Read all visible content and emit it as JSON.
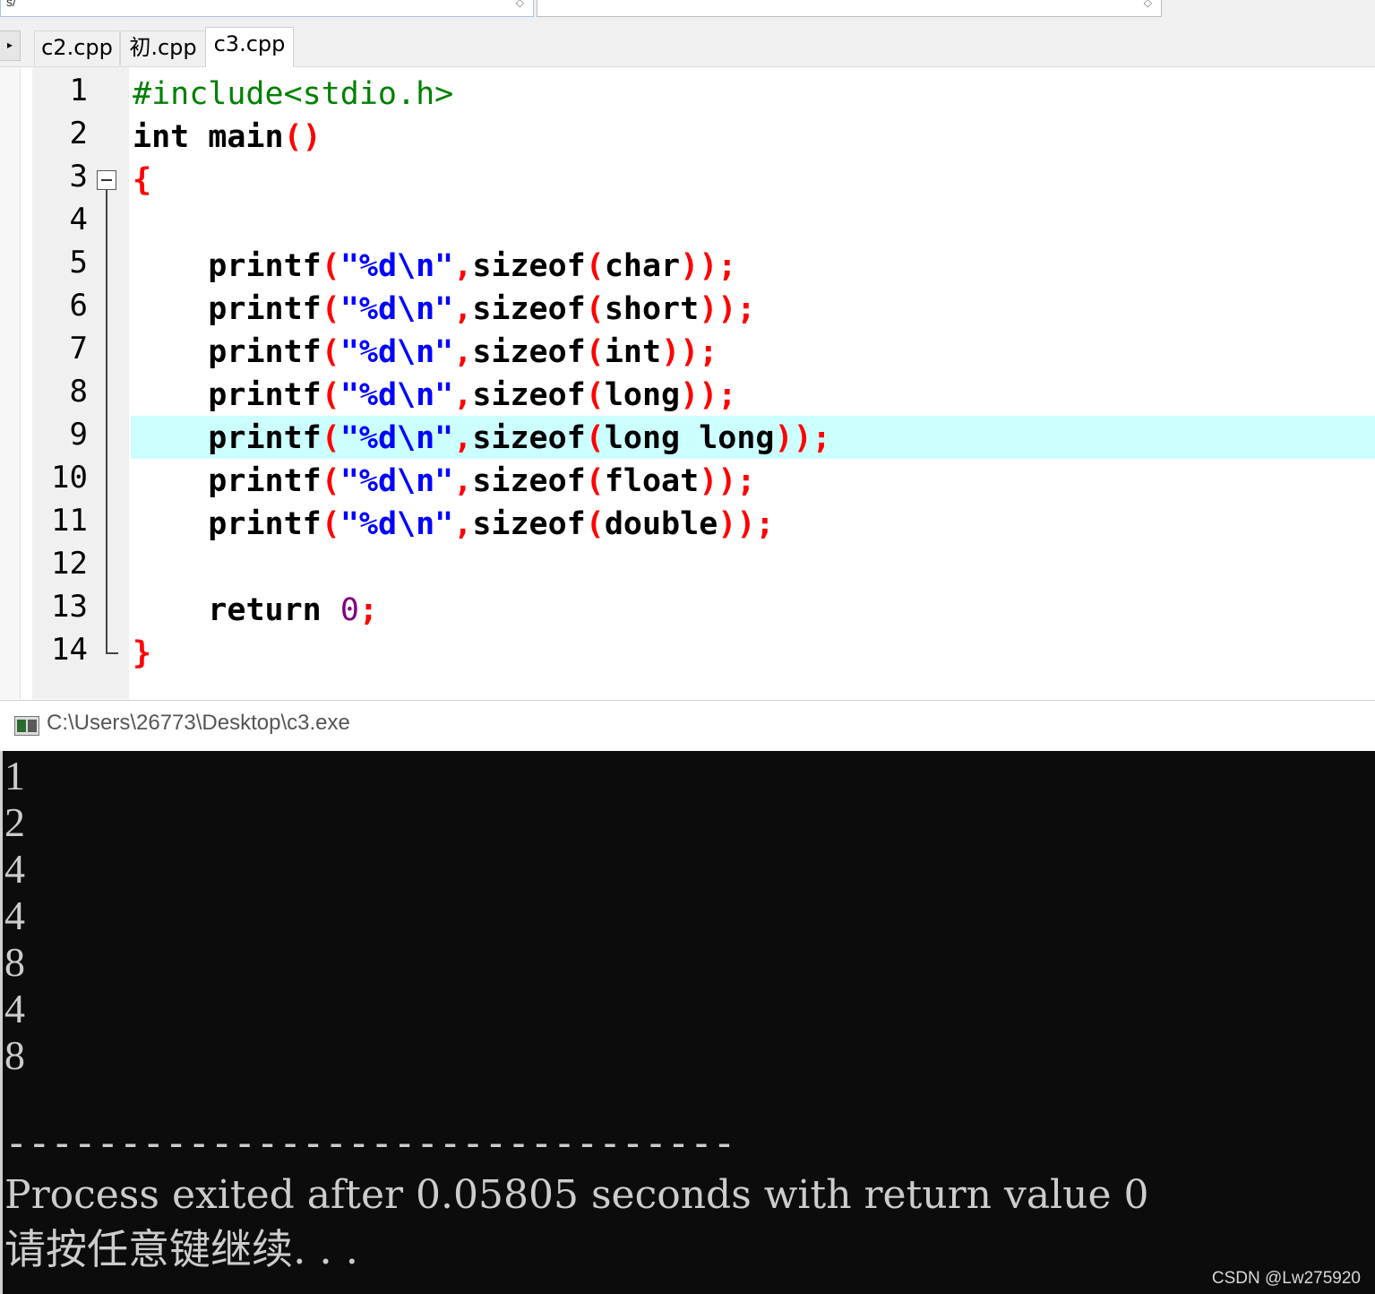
{
  "toolbar": {
    "combo1_text": "s/"
  },
  "tabs": [
    {
      "label": "c2.cpp"
    },
    {
      "label": "初.cpp"
    },
    {
      "label": "c3.cpp"
    }
  ],
  "editor": {
    "active_tab": "c3.cpp",
    "highlighted_line": 9,
    "lines": [
      {
        "n": "1"
      },
      {
        "n": "2"
      },
      {
        "n": "3"
      },
      {
        "n": "4"
      },
      {
        "n": "5"
      },
      {
        "n": "6"
      },
      {
        "n": "7"
      },
      {
        "n": "8"
      },
      {
        "n": "9"
      },
      {
        "n": "10"
      },
      {
        "n": "11"
      },
      {
        "n": "12"
      },
      {
        "n": "13"
      },
      {
        "n": "14"
      }
    ],
    "code": {
      "l1": "#include<stdio.h>",
      "l2_kw": "int",
      "l2_fn": " main",
      "l2_p": "()",
      "l3": "{",
      "printf": "printf",
      "open": "(",
      "fmt": "\"%d\\n\"",
      "comma": ",",
      "sizeof": "sizeof",
      "close": "));",
      "types": [
        "char",
        "short",
        "int",
        "long",
        "long long",
        "float",
        "double"
      ],
      "ret_kw": "return",
      "ret_val": "0",
      "semi": ";",
      "l14": "}"
    }
  },
  "console": {
    "title": "C:\\Users\\26773\\Desktop\\c3.exe",
    "outputs": [
      "1",
      "2",
      "4",
      "4",
      "8",
      "4",
      "8"
    ],
    "separator": "--------------------------------",
    "process_line": "Process exited after 0.05805 seconds with return value 0",
    "press_key": "请按任意键继续. . ."
  },
  "watermark": "CSDN @Lw275920",
  "colors": {
    "preprocessor": "#008000",
    "punctuation": "#ff0000",
    "string": "#0000ff",
    "number": "#800080",
    "current_line": "#ccffff",
    "console_bg": "#0c0c0c",
    "console_text": "#cccccc"
  }
}
